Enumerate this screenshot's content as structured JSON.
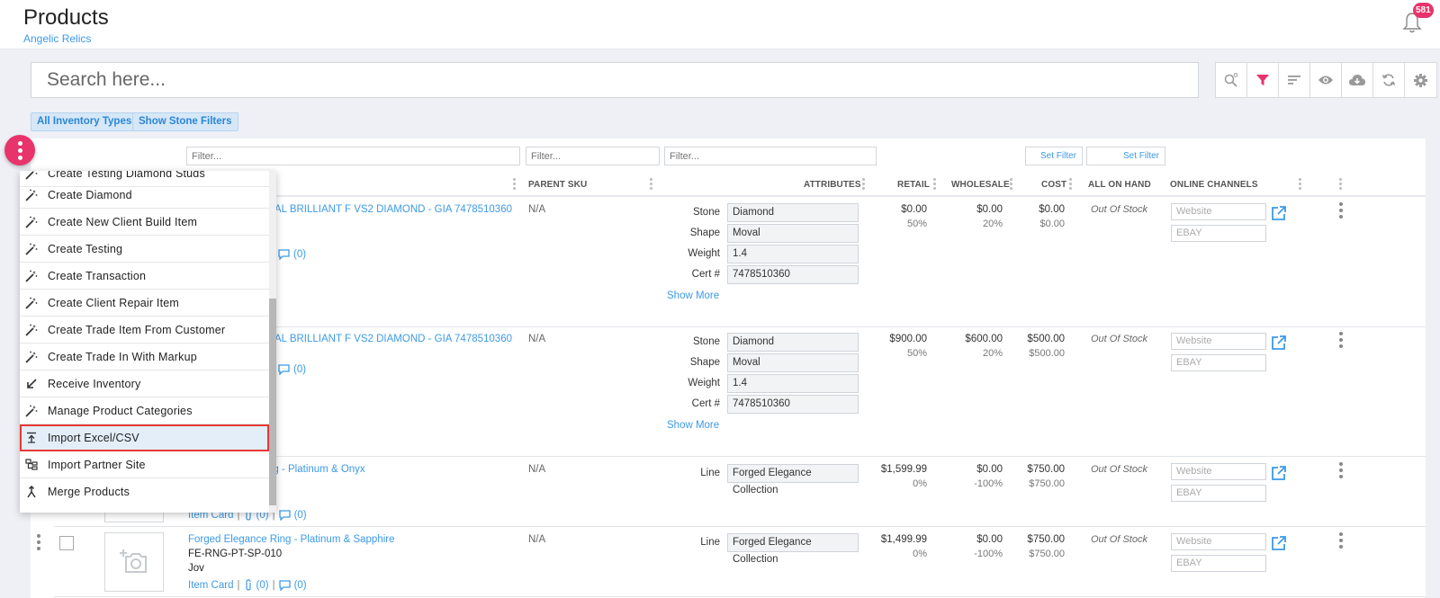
{
  "header": {
    "title": "Products",
    "subtitle": "Angelic Relics",
    "notification_count": "581"
  },
  "search": {
    "placeholder": "Search here..."
  },
  "toolbar": {
    "icons": [
      "search-settings-icon",
      "filter-icon",
      "sort-icon",
      "eye-icon",
      "cloud-download-icon",
      "sync-icon",
      "gear-icon"
    ],
    "active_color": "#e8336b"
  },
  "chips": {
    "inventory_types": "All Inventory Types",
    "stone_filters": "Show Stone Filters"
  },
  "filters": {
    "placeholder": "Filter...",
    "set_filter": "Set Filter"
  },
  "columns": {
    "parent_sku": "PARENT SKU",
    "attributes": "ATTRIBUTES",
    "retail": "RETAIL",
    "wholesale": "WHOLESALE",
    "cost": "COST",
    "all_on_hand": "ALL ON HAND",
    "online_channels": "ONLINE CHANNELS"
  },
  "menu": {
    "items": [
      {
        "label": "Create Testing Diamond Studs",
        "icon": "wand-icon"
      },
      {
        "label": "Create Diamond",
        "icon": "wand-icon"
      },
      {
        "label": "Create New Client Build Item",
        "icon": "wand-icon"
      },
      {
        "label": "Create Testing",
        "icon": "wand-icon"
      },
      {
        "label": "Create Transaction",
        "icon": "wand-icon"
      },
      {
        "label": "Create Client Repair Item",
        "icon": "wand-icon"
      },
      {
        "label": "Create Trade Item From Customer",
        "icon": "wand-icon"
      },
      {
        "label": "Create Trade In With Markup",
        "icon": "wand-icon"
      },
      {
        "label": "Receive Inventory",
        "icon": "arrow-down-left-icon"
      },
      {
        "label": "Manage Product Categories",
        "icon": "wand-icon"
      },
      {
        "label": "Import Excel/CSV",
        "icon": "upload-icon"
      },
      {
        "label": "Import Partner Site",
        "icon": "sitemap-icon"
      },
      {
        "label": "Merge Products",
        "icon": "merge-icon"
      }
    ],
    "highlighted_index": 10
  },
  "rows": [
    {
      "title_visible": "AL BRILLIANT F VS2 DIAMOND - GIA 7478510360",
      "parent_sku": "N/A",
      "comments": "(0)",
      "attributes": [
        {
          "label": "Stone",
          "value": "Diamond"
        },
        {
          "label": "Shape",
          "value": "Moval"
        },
        {
          "label": "Weight",
          "value": "1.4"
        },
        {
          "label": "Cert #",
          "value": "7478510360"
        }
      ],
      "show_more": "Show More",
      "retail": "$0.00",
      "retail_pct": "50%",
      "wholesale": "$0.00",
      "wholesale_pct": "20%",
      "cost": "$0.00",
      "cost_sub": "$0.00",
      "stock": "Out Of Stock",
      "channels": [
        "Website",
        "EBAY"
      ]
    },
    {
      "title_visible": "AL BRILLIANT F VS2 DIAMOND - GIA 7478510360",
      "parent_sku": "N/A",
      "comments": "(0)",
      "attributes": [
        {
          "label": "Stone",
          "value": "Diamond"
        },
        {
          "label": "Shape",
          "value": "Moval"
        },
        {
          "label": "Weight",
          "value": "1.4"
        },
        {
          "label": "Cert #",
          "value": "7478510360"
        }
      ],
      "show_more": "Show More",
      "retail": "$900.00",
      "retail_pct": "50%",
      "wholesale": "$600.00",
      "wholesale_pct": "20%",
      "cost": "$500.00",
      "cost_sub": "$500.00",
      "stock": "Out Of Stock",
      "channels": [
        "Website",
        "EBAY"
      ]
    },
    {
      "title_visible": "ng - Platinum & Onyx",
      "parent_sku": "N/A",
      "item_card": "Item Card",
      "attachments": "(0)",
      "comments": "(0)",
      "attributes": [
        {
          "label": "Line",
          "value": "Forged Elegance Collection"
        }
      ],
      "retail": "$1,599.99",
      "retail_pct": "0%",
      "wholesale": "$0.00",
      "wholesale_pct": "-100%",
      "cost": "$750.00",
      "cost_sub": "$750.00",
      "stock": "Out Of Stock",
      "channels": [
        "Website",
        "EBAY"
      ]
    },
    {
      "title": "Forged Elegance Ring - Platinum & Sapphire",
      "sku": "FE-RNG-PT-SP-010",
      "brand": "Jov",
      "parent_sku": "N/A",
      "item_card": "Item Card",
      "attachments": "(0)",
      "comments": "(0)",
      "attributes": [
        {
          "label": "Line",
          "value": "Forged Elegance Collection"
        }
      ],
      "retail": "$1,499.99",
      "retail_pct": "0%",
      "wholesale": "$0.00",
      "wholesale_pct": "-100%",
      "cost": "$750.00",
      "cost_sub": "$750.00",
      "stock": "Out Of Stock",
      "channels": [
        "Website",
        "EBAY"
      ]
    }
  ]
}
